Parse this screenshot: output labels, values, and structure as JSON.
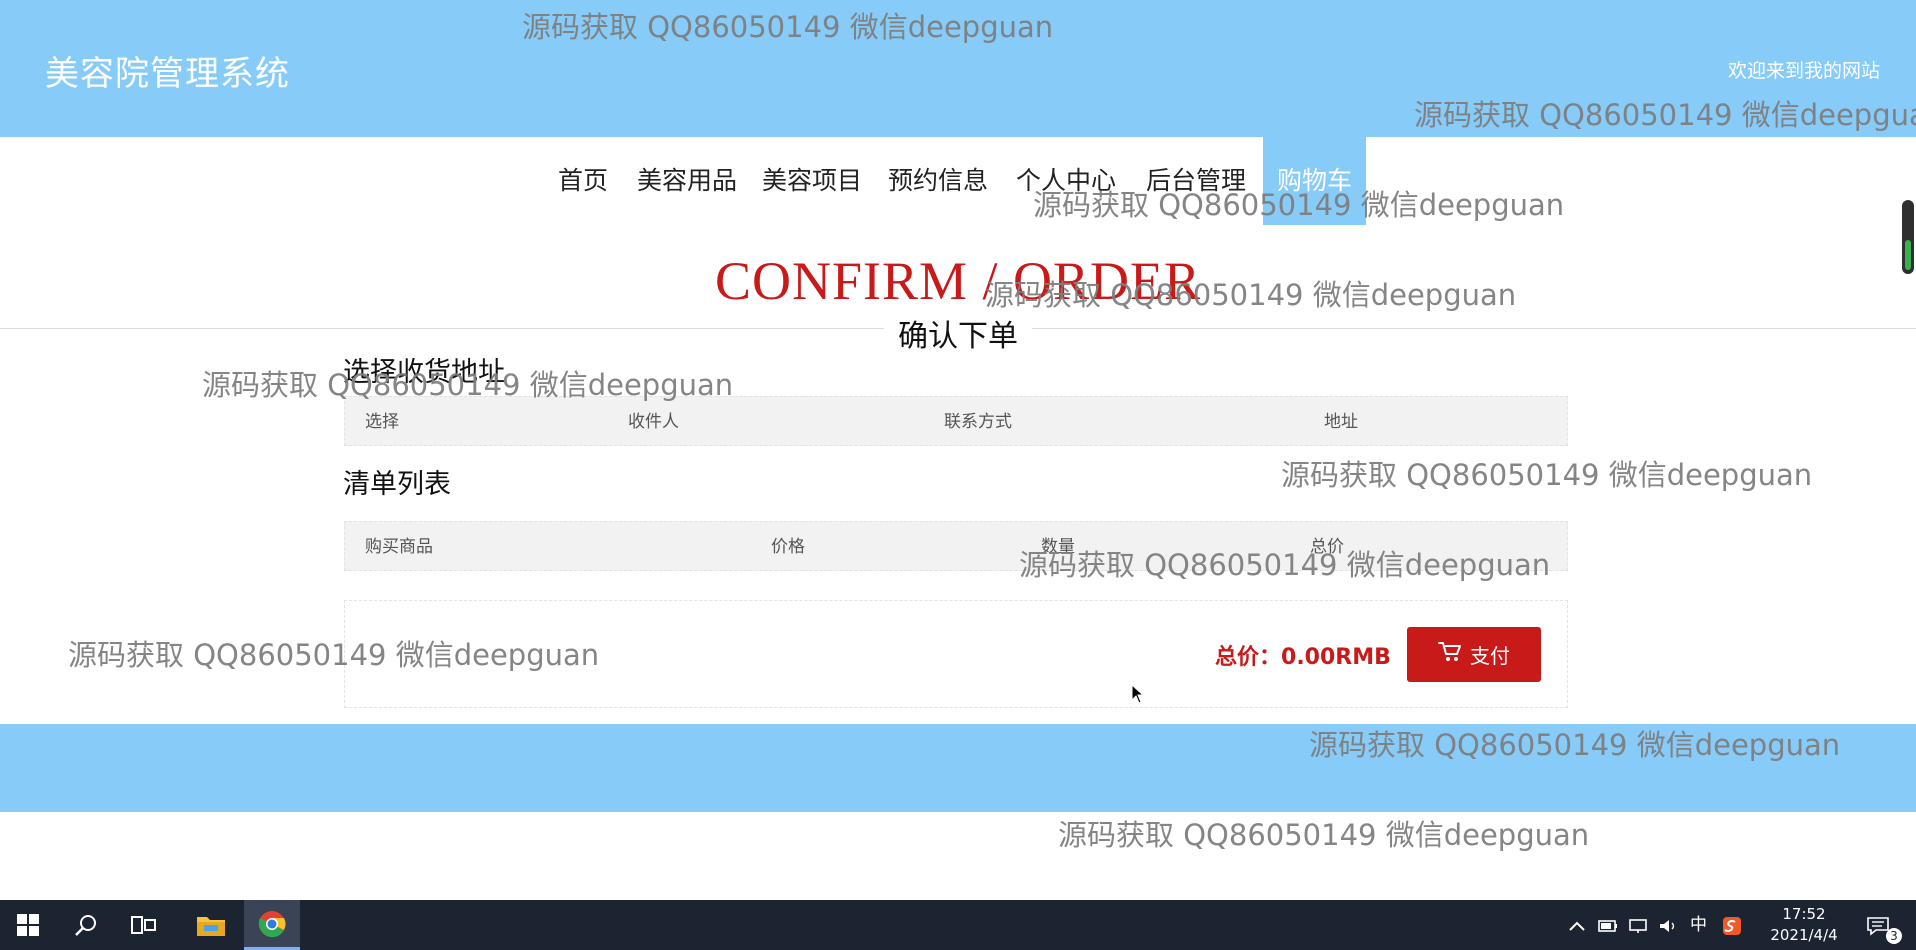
{
  "header": {
    "site_title": "美容院管理系统",
    "welcome": "欢迎来到我的网站"
  },
  "nav": {
    "items": [
      {
        "label": "首页"
      },
      {
        "label": "美容用品"
      },
      {
        "label": "美容项目"
      },
      {
        "label": "预约信息"
      },
      {
        "label": "个人中心"
      },
      {
        "label": "后台管理"
      },
      {
        "label": "购物车",
        "active": true
      }
    ]
  },
  "page": {
    "title_en": "CONFIRM / ORDER",
    "title_cn": "确认下单"
  },
  "address": {
    "title": "选择收货地址",
    "columns": [
      "选择",
      "收件人",
      "联系方式",
      "地址"
    ]
  },
  "items_list": {
    "title": "清单列表",
    "columns": [
      "购买商品",
      "价格",
      "数量",
      "总价"
    ]
  },
  "summary": {
    "total_label": "总价：",
    "total_value": "0.00RMB",
    "pay_label": "支付"
  },
  "watermark": {
    "text": "源码获取 QQ86050149 微信deepguan"
  },
  "taskbar": {
    "ime": "中",
    "time": "17:52",
    "date": "2021/4/4",
    "notifications": "3"
  },
  "colors": {
    "header_bg": "#87cbf9",
    "accent_red": "#c91a1a",
    "taskbar_bg": "#1c2432"
  }
}
